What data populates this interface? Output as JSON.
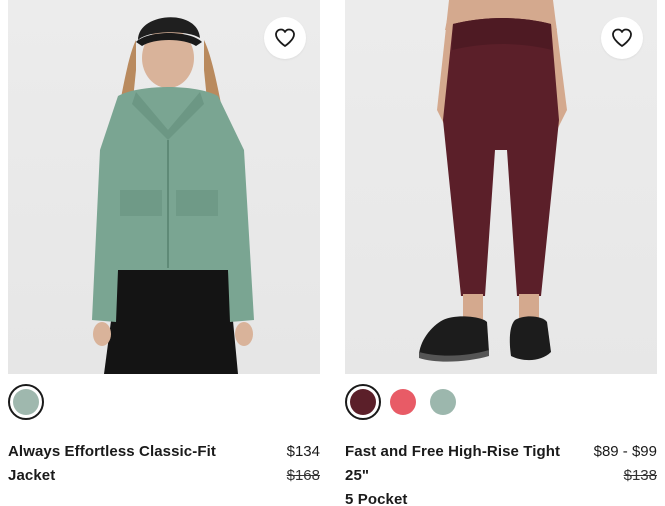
{
  "products": [
    {
      "name": "Always Effortless Classic-Fit Jacket",
      "price": "$134",
      "original_price": "$168",
      "favorite_icon": "heart-outline-icon",
      "swatches": [
        {
          "color": "#9fb8ae",
          "selected": true
        }
      ]
    },
    {
      "name": "Fast and Free High-Rise Tight 25\"",
      "subtitle": "5 Pocket",
      "price": "$89 - $99",
      "original_price": "$138",
      "favorite_icon": "heart-outline-icon",
      "swatches": [
        {
          "color": "#5b1f29",
          "selected": true
        },
        {
          "color": "#e85b66",
          "selected": false
        },
        {
          "color": "#9cb7ad",
          "selected": false
        }
      ]
    }
  ]
}
